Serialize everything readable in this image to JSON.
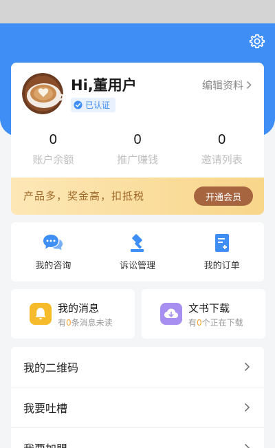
{
  "profile": {
    "greeting": "Hi,董用户",
    "verified_label": "已认证",
    "edit_label": "编辑资料"
  },
  "stats": [
    {
      "value": "0",
      "label": "账户余额"
    },
    {
      "value": "0",
      "label": "推广赚钱"
    },
    {
      "value": "0",
      "label": "邀请列表"
    }
  ],
  "vip": {
    "text": "产品多，奖金高，扣抵税",
    "button_label": "开通会员"
  },
  "actions": [
    {
      "label": "我的咨询",
      "icon": "chat-bubbles-icon"
    },
    {
      "label": "诉讼管理",
      "icon": "gavel-icon"
    },
    {
      "label": "我的订单",
      "icon": "order-document-icon"
    }
  ],
  "messages": {
    "title": "我的消息",
    "prefix": "有",
    "count": "0",
    "suffix": "条消息未读",
    "icon": "bell-icon",
    "color": "#f6bb2a"
  },
  "downloads": {
    "title": "文书下载",
    "prefix": "有",
    "count": "0",
    "suffix": "个正在下载",
    "icon": "cloud-download-icon",
    "color": "#a78ef1"
  },
  "menu": [
    {
      "label": "我的二维码"
    },
    {
      "label": "我要吐槽"
    },
    {
      "label": "我要加盟"
    }
  ],
  "colors": {
    "primary": "#3e8ef5",
    "vip_button": "#a6643f",
    "vip_text": "#a06a2b",
    "count_highlight": "#f6a33a"
  }
}
